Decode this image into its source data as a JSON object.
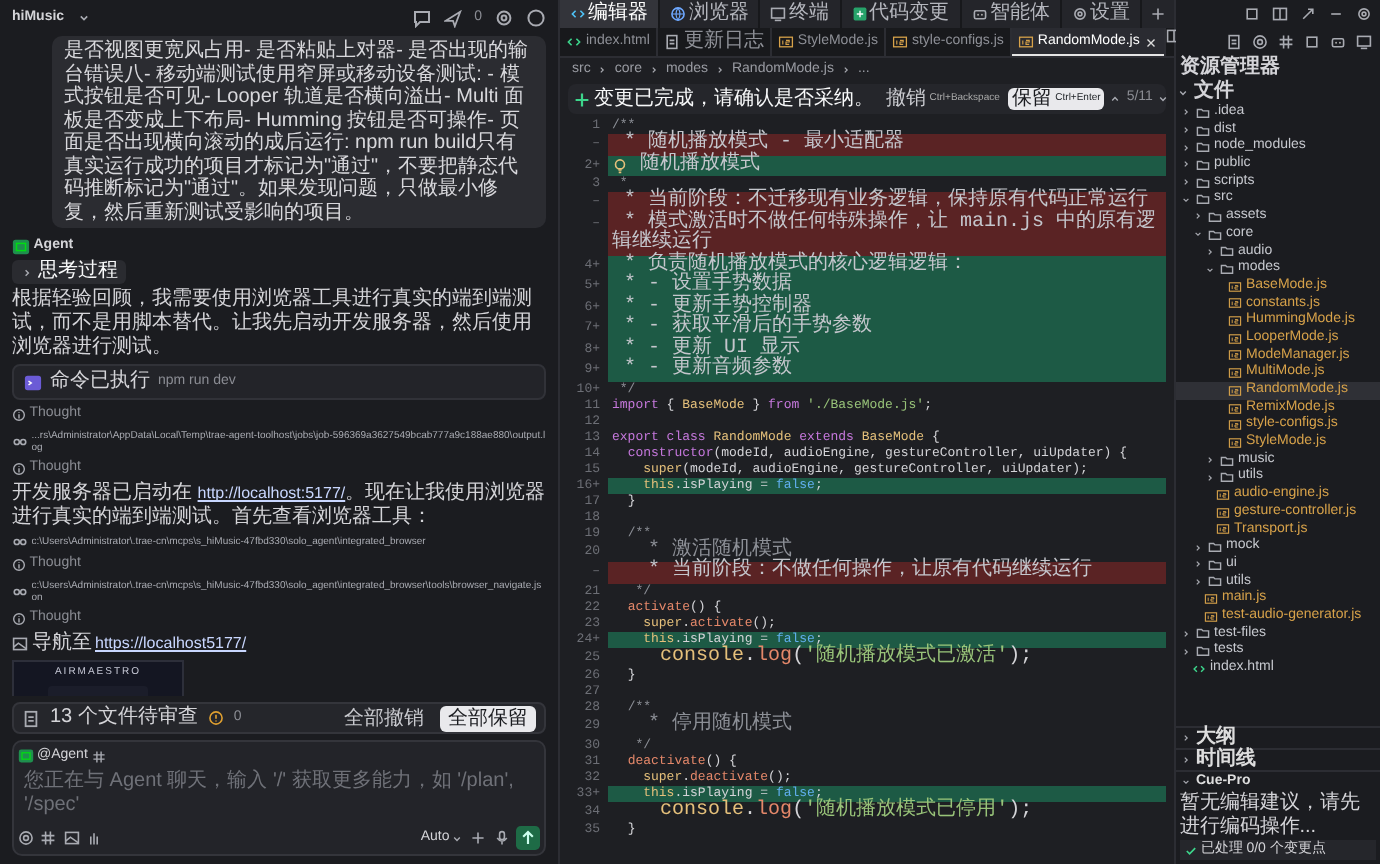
{
  "chat": {
    "project": "hiMusic",
    "notice_count": "0",
    "items": [
      {
        "kind": "user_message",
        "text": "是否视图更宽风占用- 是否粘贴上对器- 是否出现的输台错误八- 移动端测试使用窄屏或移动设备测试: - 模式按钮是否可见- Looper 轨道是否横向溢出- Multi 面板是否变成上下布局- Humming 按钮是否可操作- 页面是否出现横向滚动的成后运行: npm run build只有真实运行成功的项目才标记为\"通过\"，不要把静态代码推断标记为\"通过\"。如果发现问题，只做最小修复，然后重新测试受影响的项目。"
      },
      {
        "kind": "agent_header",
        "text": "Agent"
      },
      {
        "kind": "thinking_toggle",
        "text": "思考过程",
        "expanded": false
      },
      {
        "kind": "paragraph",
        "text": "根据轻验回顾，我需要使用浏览器工具进行真实的端到端测试，而不是用脚本替代。让我先启动开发服务器，然后使用浏览器进行测试。"
      },
      {
        "kind": "command",
        "label": "命令已执行",
        "command": "npm run dev"
      },
      {
        "kind": "thought",
        "text": "Thought"
      },
      {
        "kind": "file_path",
        "text": "...rs\\Administrator\\AppData\\Local\\Temp\\trae-agent-toolhost\\jobs\\job-596369a3627549bcab777a9c188ae880\\output.log"
      },
      {
        "kind": "thought",
        "text": "Thought"
      },
      {
        "kind": "link_paragraph",
        "before": "开发服务器已启动在",
        "link": "http://localhost:5177/",
        "after": "。现在让我使用浏览器进行真实的端到端测试。首先查看浏览器工具："
      },
      {
        "kind": "file_path",
        "text": "c:\\Users\\Administrator\\.trae-cn\\mcps\\s_hiMusic-47fbd330\\solo_agent\\integrated_browser"
      },
      {
        "kind": "thought",
        "text": "Thought"
      },
      {
        "kind": "file_path",
        "text": "c:\\Users\\Administrator\\.trae-cn\\mcps\\s_hiMusic-47fbd330\\solo_agent\\integrated_browser\\tools\\browser_navigate.json"
      },
      {
        "kind": "thought",
        "text": "Thought"
      },
      {
        "kind": "navigate",
        "label": "导航至",
        "url": "https://localhost5177/"
      },
      {
        "kind": "screenshot",
        "brand": "AIRMAESTRO"
      }
    ],
    "review": {
      "text": "13 个文件待审查",
      "warnings": "0",
      "discard": "全部撤销",
      "keep": "全部保留"
    },
    "input": {
      "mention": "@Agent",
      "placeholder": "您正在与 Agent 聊天，输入 '/' 获取更多能力，如 '/plan', '/spec'",
      "model": "Auto"
    }
  },
  "editor": {
    "tabs": [
      {
        "label": "编辑器",
        "selected": true
      },
      {
        "label": "浏览器",
        "selected": false
      },
      {
        "label": "终端",
        "selected": false
      },
      {
        "label": "代码变更",
        "selected": false
      },
      {
        "label": "智能体",
        "selected": false
      },
      {
        "label": "设置",
        "selected": false
      }
    ],
    "file_tabs": [
      {
        "label": "index.html",
        "kind": "html",
        "selected": false
      },
      {
        "label": "更新日志",
        "kind": "doc",
        "selected": false
      },
      {
        "label": "StyleMode.js",
        "kind": "js",
        "selected": false
      },
      {
        "label": "style-configs.js",
        "kind": "js",
        "selected": false
      },
      {
        "label": "RandomMode.js",
        "kind": "js",
        "selected": true
      }
    ],
    "breadcrumb": [
      "src",
      "core",
      "modes",
      "RandomMode.js",
      "..."
    ],
    "change_bar": {
      "text": "变更已完成，请确认是否采纳。",
      "undo": "撤销",
      "undo_key": "Ctrl+Backspace",
      "keep": "保留",
      "keep_key": "Ctrl+Enter",
      "position": "5/11"
    },
    "lines": [
      {
        "num": "1",
        "kind": "context",
        "segs": [
          {
            "kind": "cm",
            "t": "/**"
          }
        ]
      },
      {
        "num": "–",
        "kind": "removed",
        "segs": [
          {
            "kind": "cm",
            "t": " * 随机播放模式 - 最小适配器"
          }
        ]
      },
      {
        "num": "2+",
        "kind": "added",
        "bulb": true,
        "segs": [
          {
            "kind": "cm",
            "t": " 随机播放模式"
          }
        ]
      },
      {
        "num": "3",
        "kind": "context",
        "segs": [
          {
            "kind": "cm",
            "t": " *"
          }
        ]
      },
      {
        "num": "–",
        "kind": "removed",
        "segs": [
          {
            "kind": "cm",
            "t": " * 当前阶段：不迁移现有业务逻辑，保持原有代码正常运行"
          }
        ]
      },
      {
        "num": "–",
        "kind": "removed",
        "segs": [
          {
            "kind": "cm",
            "t": " * 模式激活时不做任何特殊操作，让 main.js 中的原有逻辑继续运行"
          }
        ]
      },
      {
        "num": "4+",
        "kind": "added",
        "segs": [
          {
            "kind": "cm",
            "t": " * 负责随机播放模式的核心逻辑逻辑："
          }
        ]
      },
      {
        "num": "5+",
        "kind": "added",
        "segs": [
          {
            "kind": "cm",
            "t": " * - 设置手势数据"
          }
        ]
      },
      {
        "num": "6+",
        "kind": "added",
        "segs": [
          {
            "kind": "cm",
            "t": " * - 更新手势控制器"
          }
        ]
      },
      {
        "num": "7+",
        "kind": "added",
        "segs": [
          {
            "kind": "cm",
            "t": " * - 获取平滑后的手势参数"
          }
        ]
      },
      {
        "num": "8+",
        "kind": "added",
        "segs": [
          {
            "kind": "cm",
            "t": " * - 更新 UI 显示"
          }
        ]
      },
      {
        "num": "9+",
        "kind": "added",
        "segs": [
          {
            "kind": "cm",
            "t": " * - 更新音频参数"
          }
        ]
      },
      {
        "num": "10+",
        "kind": "context",
        "segs": [
          {
            "kind": "cm",
            "t": " */"
          }
        ]
      },
      {
        "num": "11",
        "kind": "context",
        "segs": [
          {
            "kind": "kw",
            "t": "import"
          },
          {
            "kind": "pl",
            "t": " { "
          },
          {
            "kind": "cls",
            "t": "BaseMode"
          },
          {
            "kind": "pl",
            "t": " } "
          },
          {
            "kind": "kw",
            "t": "from"
          },
          {
            "kind": "str",
            "t": " './BaseMode.js'"
          },
          {
            "kind": "pl",
            "t": ";"
          }
        ]
      },
      {
        "num": "12",
        "kind": "context"
      },
      {
        "num": "13",
        "kind": "context",
        "segs": [
          {
            "kind": "kw",
            "t": "export class"
          },
          {
            "kind": "cls",
            "t": " RandomMode"
          },
          {
            "kind": "kw",
            "t": " extends"
          },
          {
            "kind": "cls",
            "t": " BaseMode"
          },
          {
            "kind": "pl",
            "t": " {"
          }
        ]
      },
      {
        "num": "14",
        "kind": "context",
        "segs": [
          {
            "kind": "kw",
            "t": "  constructor"
          },
          {
            "kind": "pl",
            "t": "(modeId, audioEngine, gestureController, uiUpdater) {"
          }
        ]
      },
      {
        "num": "15",
        "kind": "context",
        "segs": [
          {
            "kind": "cls",
            "t": "    super"
          },
          {
            "kind": "pl",
            "t": "(modeId, audioEngine, gestureController, uiUpdater);"
          }
        ]
      },
      {
        "num": "16+",
        "kind": "added",
        "segs": [
          {
            "kind": "cls",
            "t": "    this"
          },
          {
            "kind": "pl",
            "t": ".isPlaying = "
          },
          {
            "kind": "bool",
            "t": "false"
          },
          {
            "kind": "pl",
            "t": ";"
          }
        ]
      },
      {
        "num": "17",
        "kind": "context",
        "segs": [
          {
            "kind": "pl",
            "t": "  }"
          }
        ]
      },
      {
        "num": "18",
        "kind": "context"
      },
      {
        "num": "19",
        "kind": "context",
        "segs": [
          {
            "kind": "cm",
            "t": "  /**"
          }
        ]
      },
      {
        "num": "20",
        "kind": "context",
        "segs": [
          {
            "kind": "cm",
            "t": "   * 激活随机模式"
          }
        ]
      },
      {
        "num": "–",
        "kind": "removed",
        "segs": [
          {
            "kind": "cm",
            "t": "   * 当前阶段：不做任何操作，让原有代码继续运行"
          }
        ]
      },
      {
        "num": "21",
        "kind": "context",
        "segs": [
          {
            "kind": "cm",
            "t": "   */"
          }
        ]
      },
      {
        "num": "22",
        "kind": "context",
        "segs": [
          {
            "kind": "fn",
            "t": "  activate"
          },
          {
            "kind": "pl",
            "t": "() {"
          }
        ]
      },
      {
        "num": "23",
        "kind": "context",
        "segs": [
          {
            "kind": "cls",
            "t": "    super"
          },
          {
            "kind": "pl",
            "t": "."
          },
          {
            "kind": "fn",
            "t": "activate"
          },
          {
            "kind": "pl",
            "t": "();"
          }
        ]
      },
      {
        "num": "24+",
        "kind": "added",
        "segs": [
          {
            "kind": "cls",
            "t": "    this"
          },
          {
            "kind": "pl",
            "t": ".isPlaying = "
          },
          {
            "kind": "bool",
            "t": "false"
          },
          {
            "kind": "pl",
            "t": ";"
          }
        ]
      },
      {
        "num": "25",
        "kind": "context",
        "segs": [
          {
            "kind": "cls",
            "t": "    console"
          },
          {
            "kind": "pl",
            "t": "."
          },
          {
            "kind": "fn",
            "t": "log"
          },
          {
            "kind": "pl",
            "t": "("
          },
          {
            "kind": "str",
            "t": "'随机播放模式已激活'"
          },
          {
            "kind": "pl",
            "t": ");"
          }
        ]
      },
      {
        "num": "26",
        "kind": "context",
        "segs": [
          {
            "kind": "pl",
            "t": "  }"
          }
        ]
      },
      {
        "num": "27",
        "kind": "context"
      },
      {
        "num": "28",
        "kind": "context",
        "segs": [
          {
            "kind": "cm",
            "t": "  /**"
          }
        ]
      },
      {
        "num": "29",
        "kind": "context",
        "segs": [
          {
            "kind": "cm",
            "t": "   * 停用随机模式"
          }
        ]
      },
      {
        "num": "30",
        "kind": "context",
        "segs": [
          {
            "kind": "cm",
            "t": "   */"
          }
        ]
      },
      {
        "num": "31",
        "kind": "context",
        "segs": [
          {
            "kind": "fn",
            "t": "  deactivate"
          },
          {
            "kind": "pl",
            "t": "() {"
          }
        ]
      },
      {
        "num": "32",
        "kind": "context",
        "segs": [
          {
            "kind": "cls",
            "t": "    super"
          },
          {
            "kind": "pl",
            "t": "."
          },
          {
            "kind": "fn",
            "t": "deactivate"
          },
          {
            "kind": "pl",
            "t": "();"
          }
        ]
      },
      {
        "num": "33+",
        "kind": "added",
        "segs": [
          {
            "kind": "cls",
            "t": "    this"
          },
          {
            "kind": "pl",
            "t": ".isPlaying = "
          },
          {
            "kind": "bool",
            "t": "false"
          },
          {
            "kind": "pl",
            "t": ";"
          }
        ]
      },
      {
        "num": "34",
        "kind": "context",
        "segs": [
          {
            "kind": "cls",
            "t": "    console"
          },
          {
            "kind": "pl",
            "t": "."
          },
          {
            "kind": "fn",
            "t": "log"
          },
          {
            "kind": "pl",
            "t": "("
          },
          {
            "kind": "str",
            "t": "'随机播放模式已停用'"
          },
          {
            "kind": "pl",
            "t": ");"
          }
        ]
      },
      {
        "num": "35",
        "kind": "context",
        "segs": [
          {
            "kind": "pl",
            "t": "  }"
          }
        ]
      }
    ]
  },
  "explorer": {
    "title": "资源管理器",
    "section": "文件",
    "tree": [
      {
        "label": ".idea",
        "kind": "folder",
        "expanded": false
      },
      {
        "label": "dist",
        "kind": "folder",
        "expanded": false
      },
      {
        "label": "node_modules",
        "kind": "folder",
        "expanded": false
      },
      {
        "label": "public",
        "kind": "folder",
        "expanded": false
      },
      {
        "label": "scripts",
        "kind": "folder",
        "expanded": false
      },
      {
        "label": "src",
        "kind": "folder",
        "expanded": true,
        "children": [
          {
            "label": "assets",
            "kind": "folder",
            "expanded": false
          },
          {
            "label": "core",
            "kind": "folder",
            "expanded": true,
            "children": [
              {
                "label": "audio",
                "kind": "folder",
                "expanded": false
              },
              {
                "label": "modes",
                "kind": "folder",
                "expanded": true,
                "children": [
                  {
                    "label": "BaseMode.js",
                    "kind": "js",
                    "selected": false
                  },
                  {
                    "label": "constants.js",
                    "kind": "js",
                    "selected": false
                  },
                  {
                    "label": "HummingMode.js",
                    "kind": "js",
                    "selected": false
                  },
                  {
                    "label": "LooperMode.js",
                    "kind": "js",
                    "selected": false
                  },
                  {
                    "label": "ModeManager.js",
                    "kind": "js",
                    "selected": false
                  },
                  {
                    "label": "MultiMode.js",
                    "kind": "js",
                    "selected": false
                  },
                  {
                    "label": "RandomMode.js",
                    "kind": "js",
                    "selected": true
                  },
                  {
                    "label": "RemixMode.js",
                    "kind": "js",
                    "selected": false
                  },
                  {
                    "label": "style-configs.js",
                    "kind": "js",
                    "selected": false
                  },
                  {
                    "label": "StyleMode.js",
                    "kind": "js",
                    "selected": false
                  }
                ]
              },
              {
                "label": "music",
                "kind": "folder",
                "expanded": false
              },
              {
                "label": "utils",
                "kind": "folder",
                "expanded": false
              },
              {
                "label": "audio-engine.js",
                "kind": "js",
                "selected": false
              },
              {
                "label": "gesture-controller.js",
                "kind": "js",
                "selected": false
              },
              {
                "label": "Transport.js",
                "kind": "js",
                "selected": false
              }
            ]
          },
          {
            "label": "mock",
            "kind": "folder",
            "expanded": false
          },
          {
            "label": "ui",
            "kind": "folder",
            "expanded": false
          },
          {
            "label": "utils",
            "kind": "folder",
            "expanded": false
          },
          {
            "label": "main.js",
            "kind": "js",
            "selected": false
          },
          {
            "label": "test-audio-generator.js",
            "kind": "js",
            "selected": false
          }
        ]
      },
      {
        "label": "test-files",
        "kind": "folder",
        "expanded": false
      },
      {
        "label": "tests",
        "kind": "folder",
        "expanded": false
      },
      {
        "label": "index.html",
        "kind": "html",
        "selected": false
      }
    ],
    "sections": [
      {
        "label": "大纲",
        "expanded": false
      },
      {
        "label": "时间线",
        "expanded": false
      },
      {
        "label": "Cue-Pro",
        "expanded": true
      }
    ],
    "cue_text": "暂无编辑建议，请先进行编码操作...",
    "cue_status": "已处理 0/0 个变更点"
  }
}
